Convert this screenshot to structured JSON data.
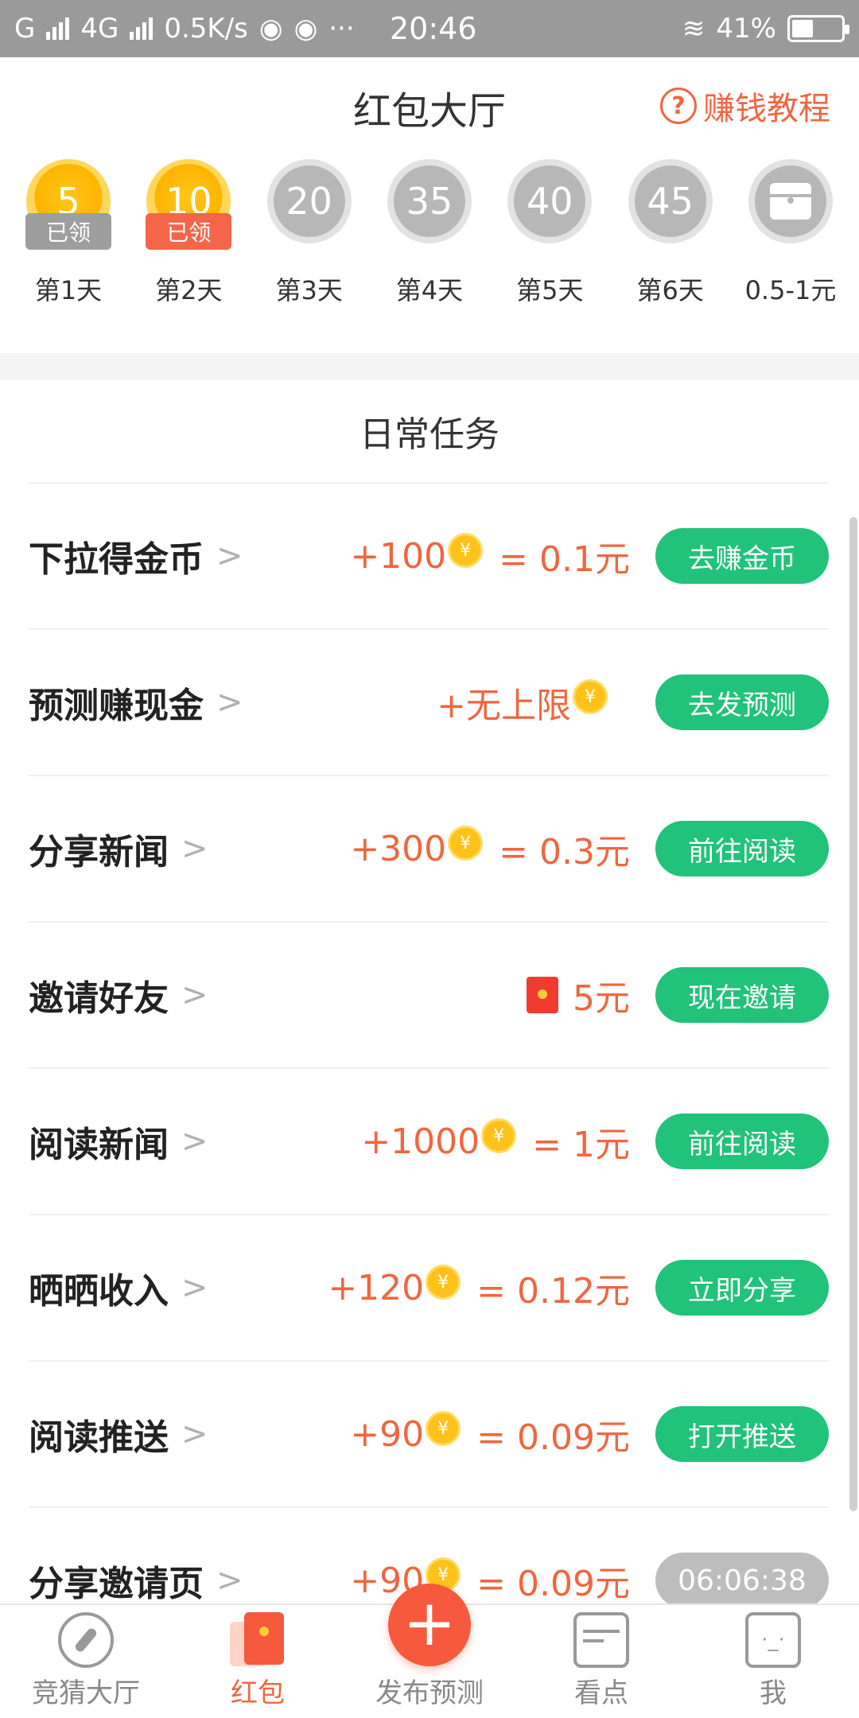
{
  "status_bar": {
    "network": "G",
    "network2": "4G",
    "speed": "0.5K/s",
    "more": "···",
    "time": "20:46",
    "battery": "41%"
  },
  "header": {
    "title": "红包大厅",
    "tutorial": "赚钱教程"
  },
  "checkin": [
    {
      "value": "5",
      "label": "第1天",
      "badge": "已领",
      "state": "claimed"
    },
    {
      "value": "10",
      "label": "第2天",
      "badge": "已领",
      "state": "claimed-today"
    },
    {
      "value": "20",
      "label": "第3天"
    },
    {
      "value": "35",
      "label": "第4天"
    },
    {
      "value": "40",
      "label": "第5天"
    },
    {
      "value": "45",
      "label": "第6天"
    },
    {
      "value": "",
      "label": "0.5-1元"
    }
  ],
  "tasks_title": "日常任务",
  "tasks": [
    {
      "name": "下拉得金币",
      "reward": "+100",
      "cash": "= 0.1元",
      "action": "去赚金币"
    },
    {
      "name": "预测赚现金",
      "reward": "+无上限",
      "cash": "",
      "action": "去发预测"
    },
    {
      "name": "分享新闻",
      "reward": "+300",
      "cash": "= 0.3元",
      "action": "前往阅读"
    },
    {
      "name": "邀请好友",
      "reward": "",
      "cash": "5元",
      "action": "现在邀请"
    },
    {
      "name": "阅读新闻",
      "reward": "+1000",
      "cash": "= 1元",
      "action": "前往阅读"
    },
    {
      "name": "晒晒收入",
      "reward": "+120",
      "cash": "= 0.12元",
      "action": "立即分享"
    },
    {
      "name": "阅读推送",
      "reward": "+90",
      "cash": "= 0.09元",
      "action": "打开推送"
    },
    {
      "name": "分享邀请页",
      "reward": "+90",
      "cash": "= 0.09元",
      "action": "06:06:38"
    }
  ],
  "nav": {
    "guess": "竞猜大厅",
    "redpacket": "红包",
    "publish": "发布预测",
    "watch": "看点",
    "me": "我"
  }
}
